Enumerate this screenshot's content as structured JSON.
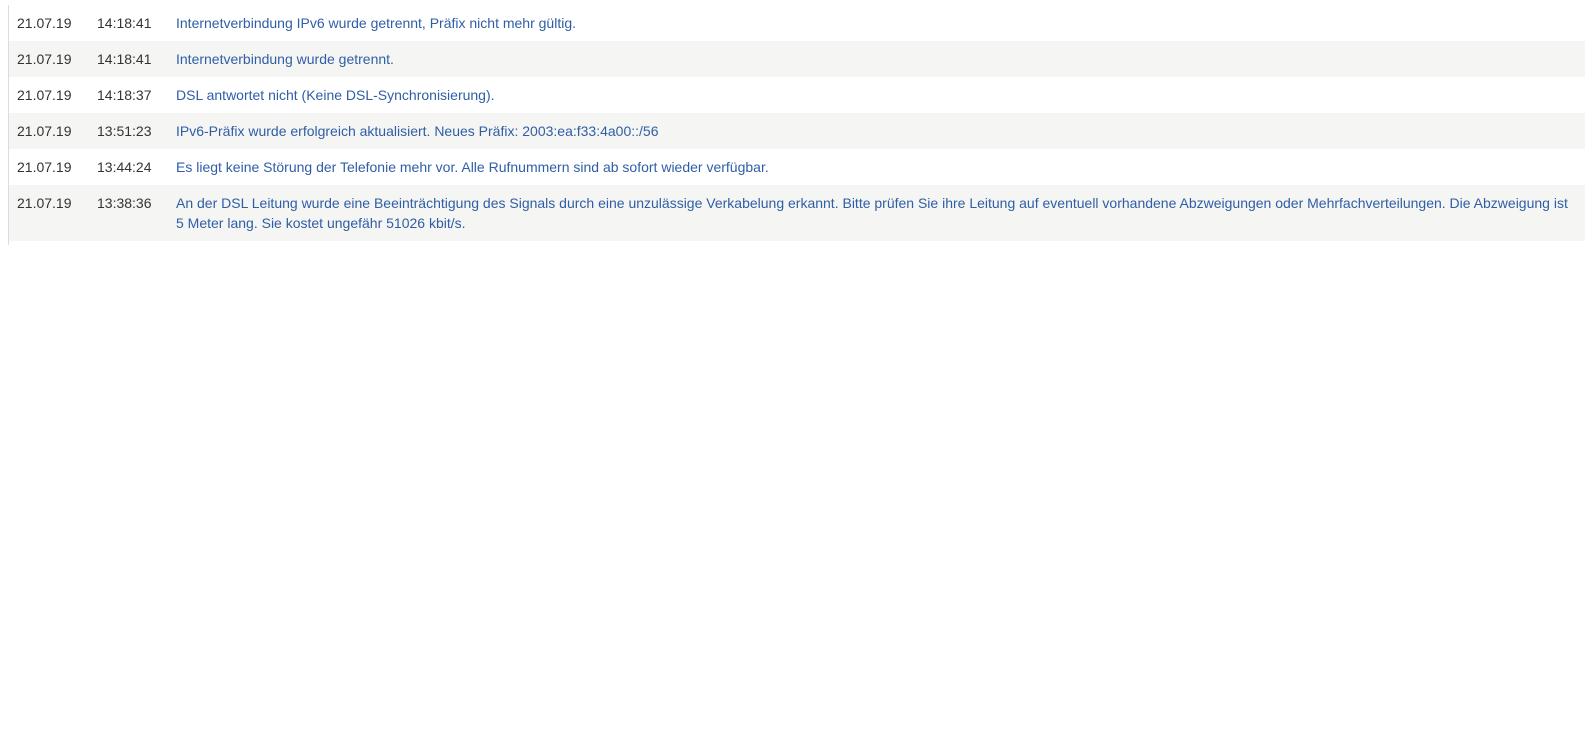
{
  "log": {
    "entries": [
      {
        "date": "21.07.19",
        "time": "14:18:41",
        "message": "Internetverbindung IPv6 wurde getrennt, Präfix nicht mehr gültig."
      },
      {
        "date": "21.07.19",
        "time": "14:18:41",
        "message": "Internetverbindung wurde getrennt."
      },
      {
        "date": "21.07.19",
        "time": "14:18:37",
        "message": "DSL antwortet nicht (Keine DSL-Synchronisierung)."
      },
      {
        "date": "21.07.19",
        "time": "13:51:23",
        "message": "IPv6-Präfix wurde erfolgreich aktualisiert. Neues Präfix: 2003:ea:f33:4a00::/56"
      },
      {
        "date": "21.07.19",
        "time": "13:44:24",
        "message": "Es liegt keine Störung der Telefonie mehr vor. Alle Rufnummern sind ab sofort wieder verfügbar."
      },
      {
        "date": "21.07.19",
        "time": "13:38:36",
        "message": "An der DSL Leitung wurde eine Beeinträchtigung des Signals durch eine unzulässige Verkabelung erkannt. Bitte prüfen Sie ihre Leitung auf eventuell vorhandene Abzweigungen oder Mehrfachverteilungen. Die Abzweigung ist 5 Meter lang. Sie kostet ungefähr 51026 kbit/s."
      }
    ]
  },
  "colors": {
    "message_link": "#2f5ea6",
    "text": "#333333",
    "row_alt_background": "#f5f5f3",
    "left_border": "#dcdcdc"
  }
}
